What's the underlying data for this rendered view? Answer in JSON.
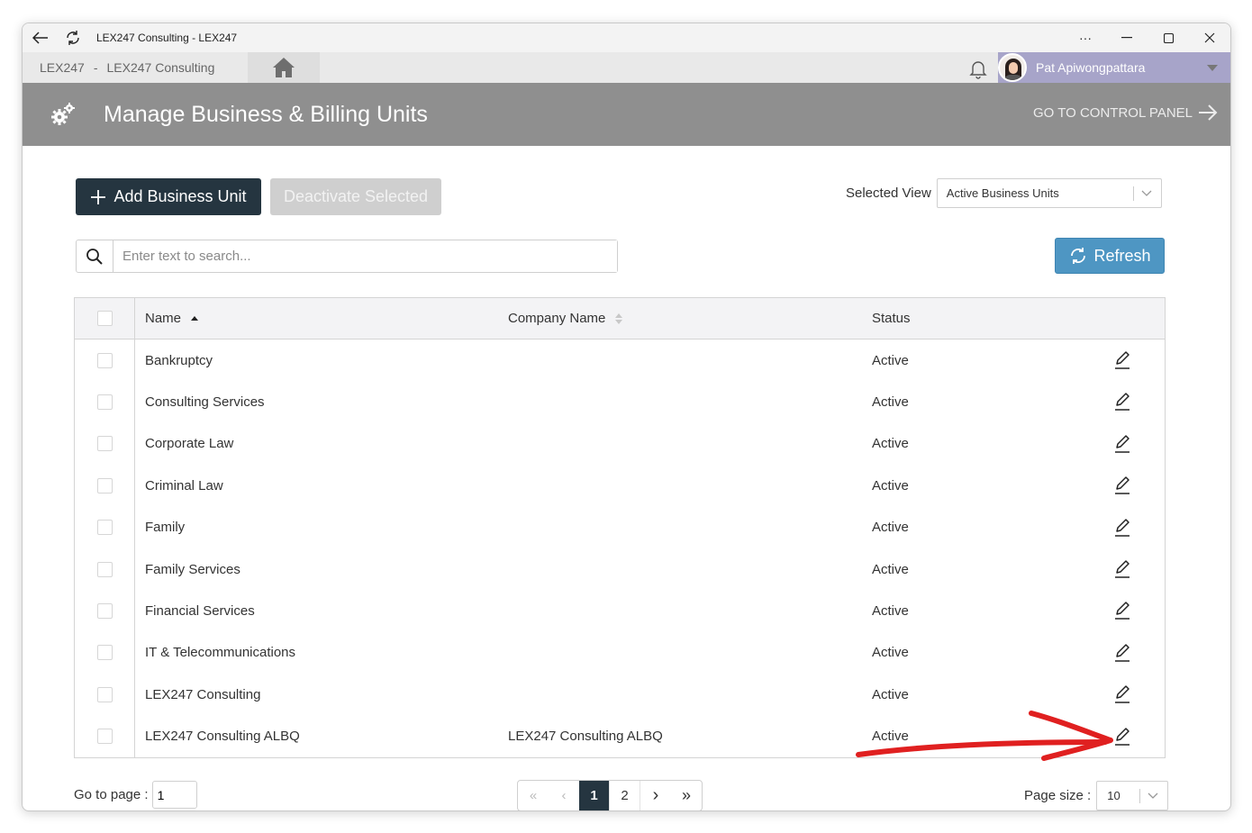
{
  "window": {
    "title": "LEX247 Consulting - LEX247"
  },
  "breadcrumb": {
    "root": "LEX247",
    "separator": "-",
    "current": "LEX247 Consulting"
  },
  "user": {
    "name": "Pat Apiwongpattara"
  },
  "header": {
    "title": "Manage Business & Billing Units",
    "goto_label": "GO TO CONTROL PANEL"
  },
  "toolbar": {
    "add_label": "Add Business Unit",
    "deactivate_label": "Deactivate Selected"
  },
  "view": {
    "label": "Selected View",
    "value": "Active Business Units"
  },
  "search": {
    "placeholder": "Enter text to search..."
  },
  "refresh": {
    "label": "Refresh"
  },
  "grid": {
    "columns": {
      "name": "Name",
      "company": "Company Name",
      "status": "Status"
    },
    "rows": [
      {
        "name": "Bankruptcy",
        "company": "",
        "status": "Active"
      },
      {
        "name": "Consulting Services",
        "company": "",
        "status": "Active"
      },
      {
        "name": "Corporate Law",
        "company": "",
        "status": "Active"
      },
      {
        "name": "Criminal Law",
        "company": "",
        "status": "Active"
      },
      {
        "name": "Family",
        "company": "",
        "status": "Active"
      },
      {
        "name": "Family Services",
        "company": "",
        "status": "Active"
      },
      {
        "name": "Financial Services",
        "company": "",
        "status": "Active"
      },
      {
        "name": "IT & Telecommunications",
        "company": "",
        "status": "Active"
      },
      {
        "name": "LEX247 Consulting",
        "company": "",
        "status": "Active"
      },
      {
        "name": "LEX247 Consulting ALBQ",
        "company": "LEX247 Consulting ALBQ",
        "status": "Active"
      }
    ]
  },
  "pagination": {
    "goto_label": "Go to page :",
    "goto_value": "1",
    "pages": [
      "1",
      "2"
    ],
    "current": "1",
    "page_size_label": "Page size :",
    "page_size_value": "10"
  },
  "colors": {
    "header_bg": "#8f8f8f",
    "primary_dark": "#253540",
    "refresh_blue": "#4e96c3",
    "user_bar": "#a7a4c9",
    "annotation": "#e02020"
  }
}
